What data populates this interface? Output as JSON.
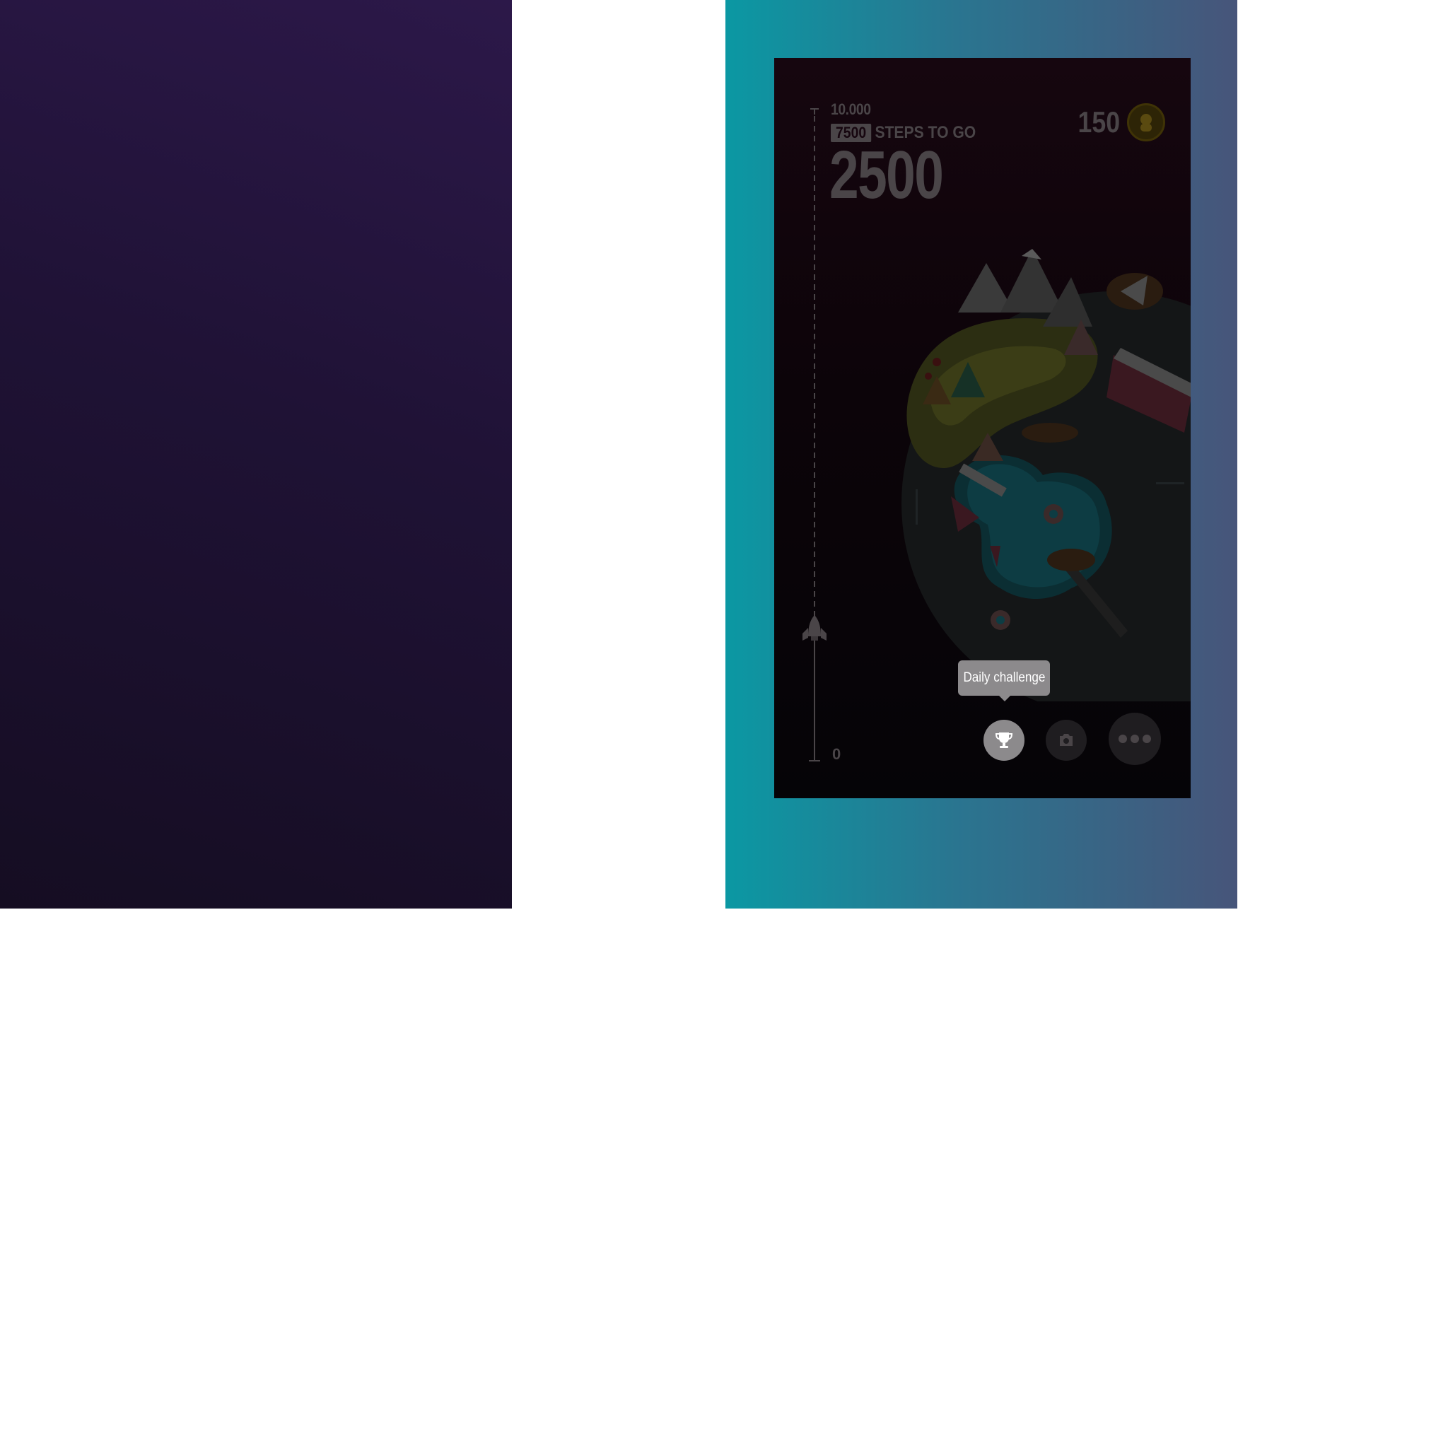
{
  "left_panel": {
    "bg_top": "#2c1849",
    "bg_bottom": "#150d22"
  },
  "right_panel": {
    "gradient": [
      "#0b98a3",
      "#47557a"
    ]
  },
  "game": {
    "goal_label": "10.000",
    "steps_remaining": "7500",
    "steps_to_go_label": "STEPS TO GO",
    "current_steps": "2500",
    "zero_label": "0",
    "coins": "150",
    "progress_fraction": 0.25,
    "tooltip": "Daily challenge",
    "buttons": {
      "trophy_icon": "trophy-icon",
      "camera_icon": "camera-icon",
      "more_icon": "more-dots-icon"
    },
    "coin_icon": "astronaut-coin-icon",
    "rocket_icon": "rocket-icon",
    "dimmed_overlay": true
  }
}
